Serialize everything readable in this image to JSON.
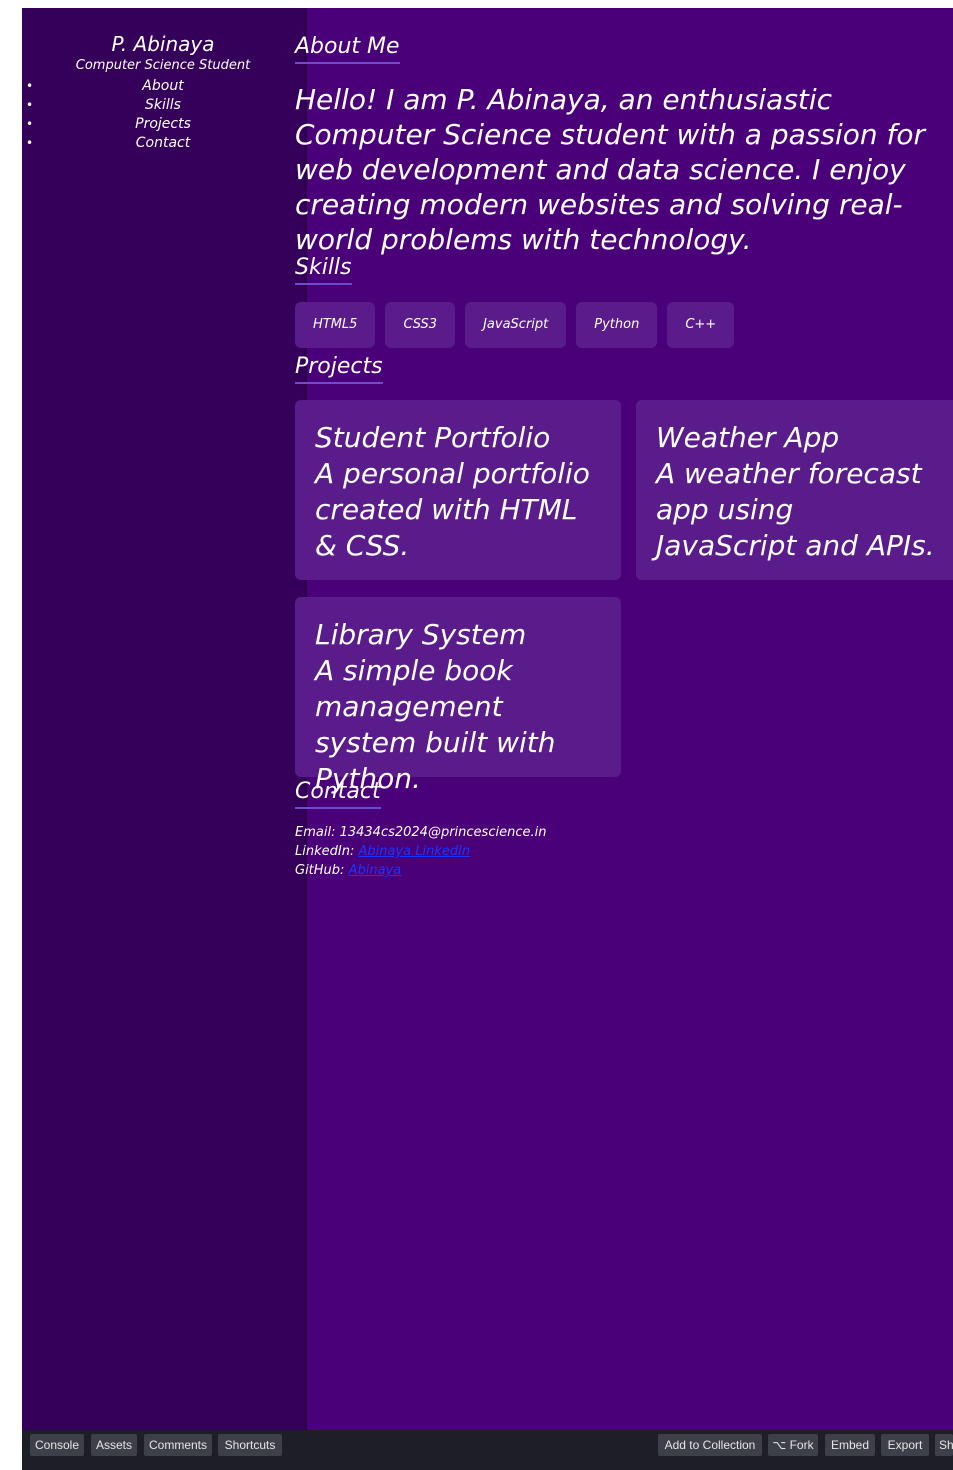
{
  "sidebar": {
    "name": "P. Abinaya",
    "subtitle": "Computer Science Student",
    "nav": [
      "About",
      "Skills",
      "Projects",
      "Contact"
    ]
  },
  "about": {
    "title": "About Me",
    "text": "Hello! I am P. Abinaya, an enthusiastic Computer Science student with a passion for web development and data science. I enjoy creating modern websites and solving real-world problems with technology."
  },
  "skills": {
    "title": "Skills",
    "items": [
      "HTML5",
      "CSS3",
      "JavaScript",
      "Python",
      "C++"
    ]
  },
  "projects": {
    "title": "Projects",
    "items": [
      {
        "title": "Student Portfolio",
        "desc": "A personal portfolio created with HTML & CSS."
      },
      {
        "title": "Weather App",
        "desc": "A weather forecast app using JavaScript and APIs."
      },
      {
        "title": "Library System",
        "desc": "A simple book management system built with Python."
      }
    ]
  },
  "contact": {
    "title": "Contact",
    "email_label": "Email:",
    "email": "13434cs2024@princescience.in",
    "linkedin_label": "LinkedIn:",
    "linkedin_link": "Abinaya LinkedIn",
    "github_label": "GitHub:",
    "github_link": "Abinaya"
  },
  "toolbar": {
    "console": "Console",
    "assets": "Assets",
    "comments": "Comments",
    "shortcuts": "Shortcuts",
    "add_to_collection": "Add to Collection",
    "fork": "⌥ Fork",
    "embed": "Embed",
    "export": "Export",
    "share": "Share"
  },
  "colors": {
    "sidebar_bg": "#34005a",
    "main_bg": "#4a0078",
    "card_bg": "#5a1c8a",
    "link": "#1a35ff"
  }
}
